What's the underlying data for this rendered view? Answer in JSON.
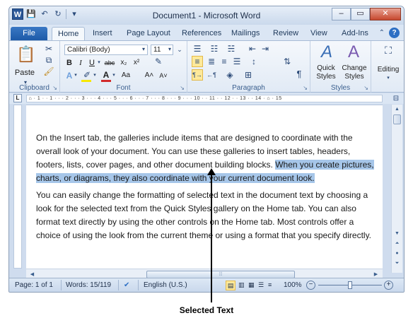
{
  "window": {
    "title": "Document1  -  Microsoft Word",
    "app_icon": "W",
    "controls": {
      "minimize": "–",
      "maximize": "▭",
      "close": "✕"
    }
  },
  "qat": {
    "save": "💾",
    "undo": "↶",
    "redo": "↻",
    "customize": "▾"
  },
  "tabs": {
    "file": "File",
    "items": [
      "Home",
      "Insert",
      "Page Layout",
      "References",
      "Mailings",
      "Review",
      "View",
      "Add-Ins"
    ]
  },
  "ribbon": {
    "clipboard": {
      "label": "Clipboard",
      "paste": "Paste"
    },
    "font": {
      "label": "Font",
      "name": "Calibri (Body)",
      "size": "11",
      "bold": "B",
      "italic": "I",
      "underline": "U",
      "strike": "abc",
      "sub": "x₂",
      "sup": "x²",
      "grow": "A˄",
      "shrink": "A˅",
      "change_case": "Aa",
      "clear": "⌫",
      "highlight_color": "#f7e800",
      "font_color": "#d22b2b"
    },
    "paragraph": {
      "label": "Paragraph"
    },
    "styles": {
      "label": "Styles",
      "quick": "Quick Styles",
      "quick_l1": "Quick",
      "quick_l2": "Styles",
      "change_l1": "Change",
      "change_l2": "Styles"
    },
    "editing": {
      "label": "Editing"
    }
  },
  "document": {
    "para1_plain": "On the Insert tab, the galleries include items that are designed to coordinate with the overall look of your document. You can use these galleries to insert tables, headers, footers, lists, cover pages, and other document building blocks. ",
    "para1_selected": "When you create pictures, charts, or diagrams, they also coordinate with your current document look.",
    "para2": "You can easily change the formatting of selected text in the document text by choosing a look for the selected text from the Quick Styles gallery on the Home tab. You can also format text directly by using the other controls on the Home tab. Most controls offer a choice of using the look from the current theme or using a format that you specify directly."
  },
  "status": {
    "page": "Page: 1 of 1",
    "words": "Words: 15/119",
    "language": "English (U.S.)",
    "zoom": "100%",
    "zoom_level": 1.0
  },
  "annotation": {
    "caption": "Selected Text"
  }
}
